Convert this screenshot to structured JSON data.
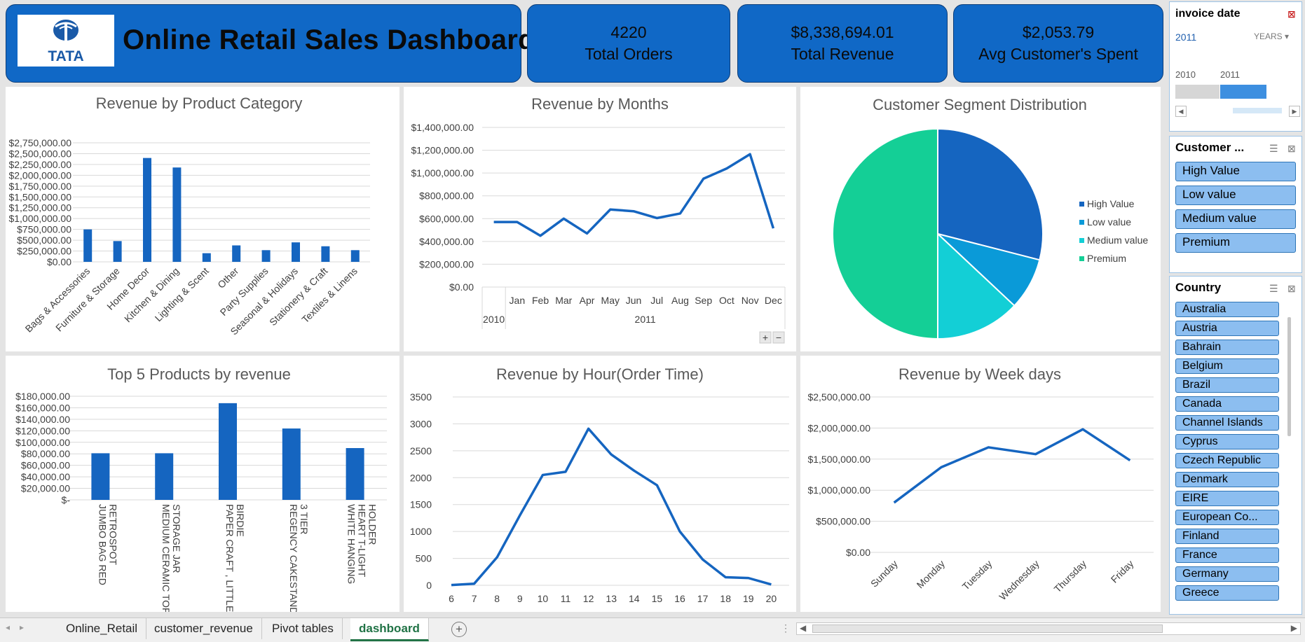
{
  "header": {
    "title": "Online Retail Sales Dashboard",
    "logo_text": "TATA",
    "kpis": [
      {
        "value": "4220",
        "label": "Total Orders"
      },
      {
        "value": "$8,338,694.01",
        "label": "Total Revenue"
      },
      {
        "value": "$2,053.79",
        "label": "Avg Customer's Spent"
      }
    ]
  },
  "colors": {
    "accent": "#1068c6",
    "series": "#1565c0",
    "pie": [
      "#1565c0",
      "#0a9ad8",
      "#13cfd6",
      "#14cf96"
    ]
  },
  "charts": [
    {
      "type": "bar",
      "title": "Revenue by Product Category",
      "categories": [
        "Bags & Accessories",
        "Furniture & Storage",
        "Home Decor",
        "Kitchen & Dining",
        "Lighting & Scent",
        "Other",
        "Party Supplies",
        "Seasonal & Holidays",
        "Stationery & Craft",
        "Textiles & Linens"
      ],
      "values": [
        750000,
        480000,
        2400000,
        2180000,
        200000,
        380000,
        270000,
        450000,
        360000,
        270000
      ],
      "ylim": [
        0,
        2750000
      ],
      "yticks": [
        "$0.00",
        "$250,000.00",
        "$500,000.00",
        "$750,000.00",
        "$1,000,000.00",
        "$1,250,000.00",
        "$1,500,000.00",
        "$1,750,000.00",
        "$2,000,000.00",
        "$2,250,000.00",
        "$2,500,000.00",
        "$2,750,000.00"
      ]
    },
    {
      "type": "line",
      "title": "Revenue by Months",
      "categories": [
        "",
        "Jan",
        "Feb",
        "Mar",
        "Apr",
        "May",
        "Jun",
        "Jul",
        "Aug",
        "Sep",
        "Oct",
        "Nov",
        "Dec"
      ],
      "groups": [
        "2010",
        "2011"
      ],
      "values": [
        570000,
        570000,
        450000,
        600000,
        470000,
        680000,
        665000,
        605000,
        645000,
        950000,
        1040000,
        1165000,
        515000
      ],
      "ylim": [
        0,
        1400000
      ],
      "yticks": [
        "$0.00",
        "$200,000.00",
        "$400,000.00",
        "$600,000.00",
        "$800,000.00",
        "$1,000,000.00",
        "$1,200,000.00",
        "$1,400,000.00"
      ],
      "buttons": [
        "+",
        "−"
      ]
    },
    {
      "type": "pie",
      "title": "Customer Segment Distribution",
      "labels": [
        "High Value",
        "Low value",
        "Medium value",
        "Premium"
      ],
      "values": [
        29,
        8,
        13,
        50
      ]
    },
    {
      "type": "bar",
      "title": "Top 5 Products by revenue",
      "categories": [
        "JUMBO BAG RED RETROSPOT",
        "MEDIUM CERAMIC TOP STORAGE JAR",
        "PAPER CRAFT , LITTLE BIRDIE",
        "REGENCY CAKESTAND 3 TIER",
        "WHITE HANGING HEART T-LIGHT HOLDER"
      ],
      "category_lines": [
        [
          "JUMBO BAG RED",
          "RETROSPOT"
        ],
        [
          "MEDIUM CERAMIC TOP",
          "STORAGE JAR"
        ],
        [
          "PAPER CRAFT , LITTLE",
          "BIRDIE"
        ],
        [
          "REGENCY CAKESTAND",
          "3 TIER"
        ],
        [
          "WHITE HANGING",
          "HEART T-LIGHT",
          "HOLDER"
        ]
      ],
      "values": [
        81000,
        81000,
        168000,
        124000,
        90000
      ],
      "ylim": [
        0,
        180000
      ],
      "yticks": [
        "$-",
        "$20,000.00",
        "$40,000.00",
        "$60,000.00",
        "$80,000.00",
        "$100,000.00",
        "$120,000.00",
        "$140,000.00",
        "$160,000.00",
        "$180,000.00"
      ]
    },
    {
      "type": "line",
      "title": "Revenue by Hour(Order Time)",
      "categories": [
        "6",
        "7",
        "8",
        "9",
        "10",
        "11",
        "12",
        "13",
        "14",
        "15",
        "16",
        "17",
        "18",
        "19",
        "20"
      ],
      "values": [
        5,
        30,
        520,
        1300,
        2050,
        2110,
        2910,
        2430,
        2130,
        1860,
        1000,
        480,
        150,
        135,
        15
      ],
      "ylim": [
        0,
        3500
      ],
      "yticks": [
        "0",
        "500",
        "1000",
        "1500",
        "2000",
        "2500",
        "3000",
        "3500"
      ]
    },
    {
      "type": "line",
      "title": "Revenue by Week days",
      "categories": [
        "Sunday",
        "Monday",
        "Tuesday",
        "Wednesday",
        "Thursday",
        "Friday"
      ],
      "values": [
        800000,
        1370000,
        1690000,
        1580000,
        1980000,
        1480000
      ],
      "ylim": [
        0,
        2500000
      ],
      "yticks": [
        "$0.00",
        "$500,000.00",
        "$1,000,000.00",
        "$1,500,000.00",
        "$2,000,000.00",
        "$2,500,000.00"
      ]
    }
  ],
  "slicers": {
    "invoice_date": {
      "title": "invoice date",
      "selected": "2011",
      "level": "YEARS",
      "years": [
        "2010",
        "2011"
      ]
    },
    "customer": {
      "title": "Customer ...",
      "items": [
        "High Value",
        "Low value",
        "Medium value",
        "Premium"
      ]
    },
    "country": {
      "title": "Country",
      "items": [
        "Australia",
        "Austria",
        "Bahrain",
        "Belgium",
        "Brazil",
        "Canada",
        "Channel Islands",
        "Cyprus",
        "Czech Republic",
        "Denmark",
        "EIRE",
        "European Co...",
        "Finland",
        "France",
        "Germany",
        "Greece"
      ]
    }
  },
  "sheet_tabs": [
    "Online_Retail",
    "customer_revenue",
    "Pivot tables",
    "dashboard"
  ],
  "active_tab": "dashboard"
}
